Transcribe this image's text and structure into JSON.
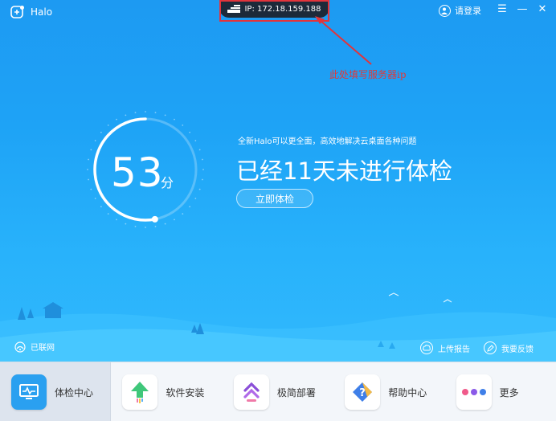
{
  "app": {
    "name": "Halo"
  },
  "titlebar": {
    "ip_text": "IP: 172.18.159.188",
    "login_label": "请登录",
    "menu_glyph": "☰",
    "min_glyph": "—",
    "close_glyph": "✕"
  },
  "annotation": {
    "text": "此处填写服务器ip",
    "color": "#e23838"
  },
  "checkup": {
    "score": "53",
    "unit": "分",
    "progress_percent": 53,
    "subline": "全新Halo可以更全面，高效地解决云桌面各种问题",
    "headline": "已经11天未进行体检",
    "button_label": "立即体检"
  },
  "status": {
    "network": "已联网",
    "upload": "上传报告",
    "feedback": "我要反馈"
  },
  "nav": {
    "items": [
      {
        "label": "体检中心",
        "icon": "monitor-pulse-icon"
      },
      {
        "label": "软件安装",
        "icon": "green-up-arrow-icon"
      },
      {
        "label": "极简部署",
        "icon": "purple-chevrons-icon"
      },
      {
        "label": "帮助中心",
        "icon": "help-diamond-icon"
      },
      {
        "label": "更多",
        "icon": "three-dots-icon"
      }
    ]
  },
  "colors": {
    "primary": "#1d9af2",
    "accent": "#e2343b",
    "active_nav": "#dde4ee"
  }
}
